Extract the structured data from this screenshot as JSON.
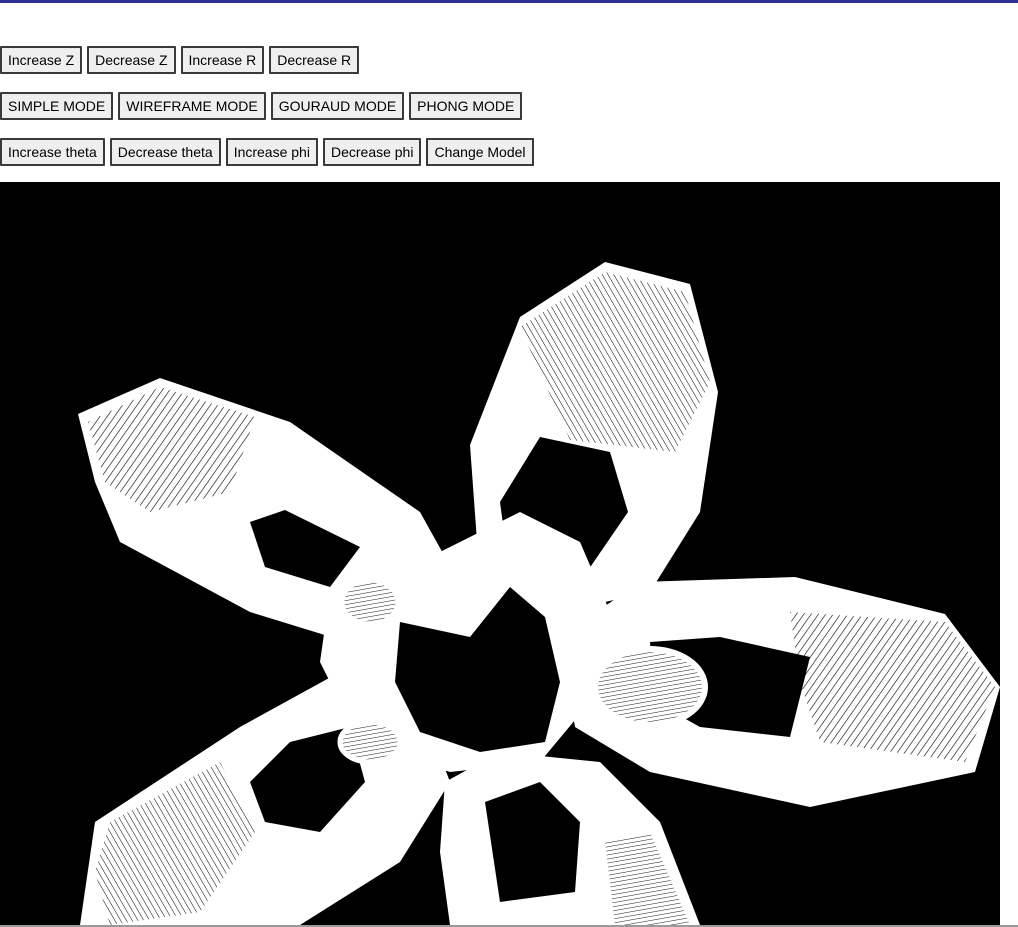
{
  "toolbar": {
    "row1": [
      "Increase Z",
      "Decrease Z",
      "Increase R",
      "Decrease R"
    ],
    "row2": [
      "SIMPLE MODE",
      "WIREFRAME MODE",
      "GOURAUD MODE",
      "PHONG MODE"
    ],
    "row3": [
      "Increase theta",
      "Decrease theta",
      "Increase phi",
      "Decrease phi",
      "Change Model"
    ]
  },
  "canvas": {
    "background": "#000000",
    "model_color": "#ffffff"
  },
  "colors": {
    "accent_bar": "#2e3192",
    "button_bg": "#efefef",
    "button_border": "#3a3a3a"
  }
}
